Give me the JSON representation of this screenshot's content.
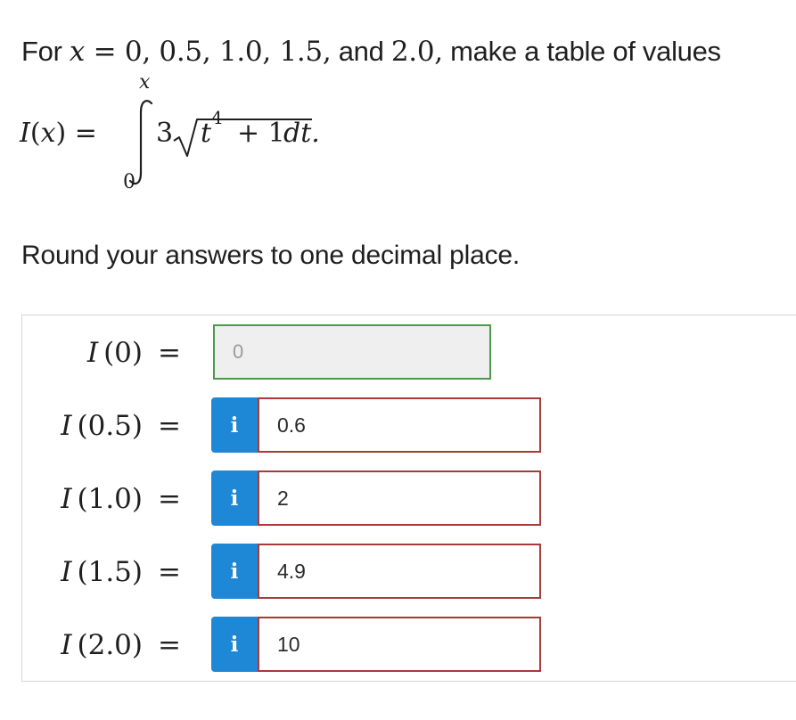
{
  "prompt": {
    "lead": "For ",
    "var": "x",
    "equals": " = ",
    "values": "0, 0.5, 1.0, 1.5,",
    "and_word": " and ",
    "last_value": "2.0,",
    "trail": " make a table of values"
  },
  "formula": {
    "func": "I",
    "lparen": "(",
    "arg": "x",
    "rparen": ")",
    "eq": "=",
    "upper_limit": "x",
    "lower_limit": "0",
    "coef": "3",
    "radicand_var": "t",
    "exponent": "4",
    "plus_one": "+ 1",
    "differential": "dt."
  },
  "instruction": "Round your answers to one decimal place.",
  "rows": [
    {
      "label_func": "I",
      "label_arg": "(0)",
      "eq": "=",
      "value": "0",
      "locked": true
    },
    {
      "label_func": "I",
      "label_arg": "(0.5)",
      "eq": "=",
      "value": "0.6",
      "info": "i"
    },
    {
      "label_func": "I",
      "label_arg": "(1.0)",
      "eq": "=",
      "value": "2",
      "info": "i"
    },
    {
      "label_func": "I",
      "label_arg": "(1.5)",
      "eq": "=",
      "value": "4.9",
      "info": "i"
    },
    {
      "label_func": "I",
      "label_arg": "(2.0)",
      "eq": "=",
      "value": "10",
      "info": "i"
    }
  ],
  "colors": {
    "info_button": "#1e88d6",
    "correct_border": "#4c9a4c",
    "incorrect_border": "#a83a3a"
  },
  "icons": {
    "info": "info-icon"
  }
}
